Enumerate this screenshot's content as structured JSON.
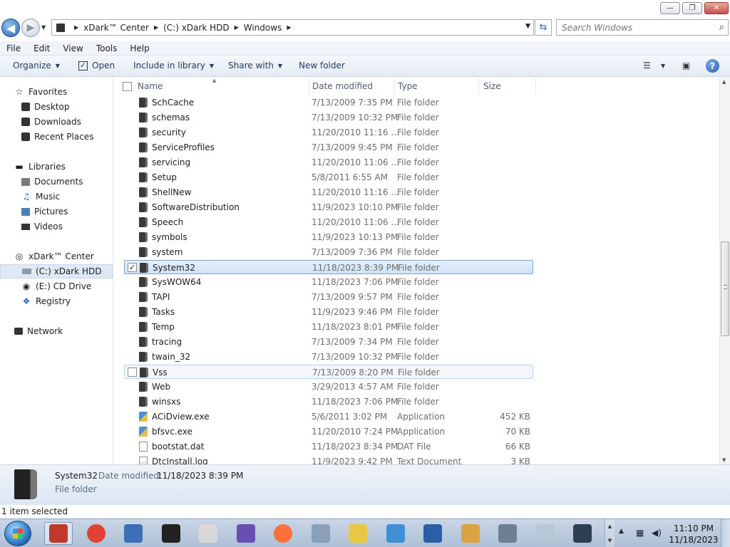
{
  "window": {
    "minimize_glyph": "—",
    "maximize_glyph": "❐",
    "close_glyph": "✕"
  },
  "address": {
    "breadcrumbs": [
      "xDark™ Center",
      "(C:) xDark HDD",
      "Windows"
    ],
    "search_placeholder": "Search Windows"
  },
  "menu": [
    "File",
    "Edit",
    "View",
    "Tools",
    "Help"
  ],
  "toolbar": {
    "organize": "Organize",
    "open": "Open",
    "include_in_library": "Include in library",
    "share_with": "Share with",
    "new_folder": "New folder"
  },
  "nav": {
    "favorites": "Favorites",
    "desktop": "Desktop",
    "downloads": "Downloads",
    "recent_places": "Recent Places",
    "libraries": "Libraries",
    "documents": "Documents",
    "music": "Music",
    "pictures": "Pictures",
    "videos": "Videos",
    "computer": "xDark™ Center",
    "c_drive": "(C:) xDark HDD",
    "e_drive": "(E:) CD Drive",
    "registry": "Registry",
    "network": "Network"
  },
  "columns": {
    "name": "Name",
    "date_modified": "Date modified",
    "type": "Type",
    "size": "Size"
  },
  "files": [
    {
      "name": "SchCache",
      "date": "7/13/2009 7:35 PM",
      "type": "File folder",
      "size": "",
      "icon": "folder"
    },
    {
      "name": "schemas",
      "date": "7/13/2009 10:32 PM",
      "type": "File folder",
      "size": "",
      "icon": "folder"
    },
    {
      "name": "security",
      "date": "11/20/2010 11:16 ...",
      "type": "File folder",
      "size": "",
      "icon": "folder"
    },
    {
      "name": "ServiceProfiles",
      "date": "7/13/2009 9:45 PM",
      "type": "File folder",
      "size": "",
      "icon": "folder"
    },
    {
      "name": "servicing",
      "date": "11/20/2010 11:06 ...",
      "type": "File folder",
      "size": "",
      "icon": "folder"
    },
    {
      "name": "Setup",
      "date": "5/8/2011 6:55 AM",
      "type": "File folder",
      "size": "",
      "icon": "folder"
    },
    {
      "name": "ShellNew",
      "date": "11/20/2010 11:16 ...",
      "type": "File folder",
      "size": "",
      "icon": "folder"
    },
    {
      "name": "SoftwareDistribution",
      "date": "11/9/2023 10:10 PM",
      "type": "File folder",
      "size": "",
      "icon": "folder"
    },
    {
      "name": "Speech",
      "date": "11/20/2010 11:06 ...",
      "type": "File folder",
      "size": "",
      "icon": "folder"
    },
    {
      "name": "symbols",
      "date": "11/9/2023 10:13 PM",
      "type": "File folder",
      "size": "",
      "icon": "folder"
    },
    {
      "name": "system",
      "date": "7/13/2009 7:36 PM",
      "type": "File folder",
      "size": "",
      "icon": "folder"
    },
    {
      "name": "System32",
      "date": "11/18/2023 8:39 PM",
      "type": "File folder",
      "size": "",
      "icon": "folder",
      "state": "selected"
    },
    {
      "name": "SysWOW64",
      "date": "11/18/2023 7:06 PM",
      "type": "File folder",
      "size": "",
      "icon": "folder"
    },
    {
      "name": "TAPI",
      "date": "7/13/2009 9:57 PM",
      "type": "File folder",
      "size": "",
      "icon": "folder"
    },
    {
      "name": "Tasks",
      "date": "11/9/2023 9:46 PM",
      "type": "File folder",
      "size": "",
      "icon": "folder"
    },
    {
      "name": "Temp",
      "date": "11/18/2023 8:01 PM",
      "type": "File folder",
      "size": "",
      "icon": "folder"
    },
    {
      "name": "tracing",
      "date": "7/13/2009 7:34 PM",
      "type": "File folder",
      "size": "",
      "icon": "folder"
    },
    {
      "name": "twain_32",
      "date": "7/13/2009 10:32 PM",
      "type": "File folder",
      "size": "",
      "icon": "folder"
    },
    {
      "name": "Vss",
      "date": "7/13/2009 8:20 PM",
      "type": "File folder",
      "size": "",
      "icon": "folder",
      "state": "hover"
    },
    {
      "name": "Web",
      "date": "3/29/2013 4:57 AM",
      "type": "File folder",
      "size": "",
      "icon": "folder"
    },
    {
      "name": "winsxs",
      "date": "11/18/2023 7:06 PM",
      "type": "File folder",
      "size": "",
      "icon": "folder"
    },
    {
      "name": "ACiDview.exe",
      "date": "5/6/2011 3:02 PM",
      "type": "Application",
      "size": "452 KB",
      "icon": "app"
    },
    {
      "name": "bfsvc.exe",
      "date": "11/20/2010 7:24 PM",
      "type": "Application",
      "size": "70 KB",
      "icon": "app"
    },
    {
      "name": "bootstat.dat",
      "date": "11/18/2023 8:34 PM",
      "type": "DAT File",
      "size": "66 KB",
      "icon": "dat"
    },
    {
      "name": "DtcInstall.log",
      "date": "11/9/2023 9:42 PM",
      "type": "Text Document",
      "size": "3 KB",
      "icon": "txt"
    }
  ],
  "details": {
    "name": "System32",
    "modified_label": "Date modified:",
    "modified_value": "11/18/2023 8:39 PM",
    "type": "File folder"
  },
  "status": {
    "selection": "1 item selected"
  },
  "taskbar": {
    "time": "11:10 PM",
    "date": "11/18/2023",
    "pinned": [
      {
        "name": "explorer-icon",
        "color": "#c0392b",
        "active": true
      },
      {
        "name": "chrome-icon",
        "color": "#e34133"
      },
      {
        "name": "app-icon-1",
        "color": "#3b6fb6"
      },
      {
        "name": "app-icon-2",
        "color": "#222222"
      },
      {
        "name": "app-icon-3",
        "color": "#d8d8d8"
      },
      {
        "name": "app-icon-4",
        "color": "#6a4fb3"
      },
      {
        "name": "firefox-icon",
        "color": "#ff7139"
      },
      {
        "name": "app-icon-5",
        "color": "#8aa0b8"
      },
      {
        "name": "hxd-icon",
        "color": "#e8c842"
      },
      {
        "name": "app-icon-6",
        "color": "#3f8fd2"
      },
      {
        "name": "app-icon-7",
        "color": "#2a5fa8"
      },
      {
        "name": "paint-icon",
        "color": "#d9a441"
      },
      {
        "name": "app-icon-8",
        "color": "#6e7f91"
      },
      {
        "name": "app-icon-9",
        "color": "#b8c6d6"
      },
      {
        "name": "app-icon-10",
        "color": "#2c3e50"
      }
    ]
  }
}
